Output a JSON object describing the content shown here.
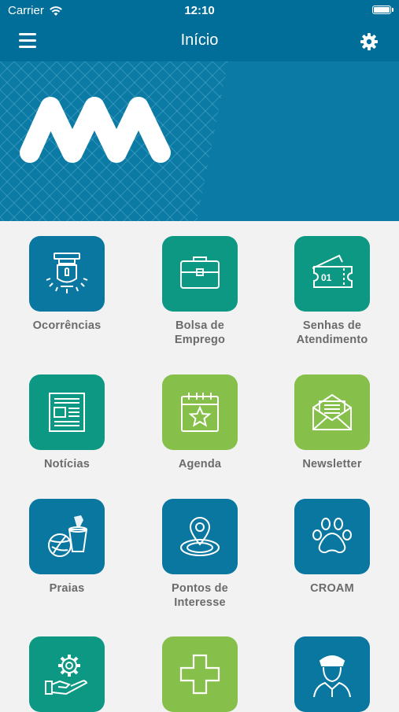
{
  "status": {
    "carrier": "Carrier",
    "time": "12:10"
  },
  "nav": {
    "title": "Início",
    "menu_icon": "menu-icon",
    "settings_icon": "gear-icon"
  },
  "colors": {
    "header": "#006e99",
    "blue_tile": "#0a77a1",
    "teal_tile": "#0c9882",
    "green_tile": "#86c04a",
    "label": "#6b6b6b",
    "background": "#f2f2f2"
  },
  "tiles": [
    {
      "label": "Ocorrências",
      "icon": "siren-icon",
      "color": "blue"
    },
    {
      "label": "Bolsa de\nEmprego",
      "icon": "briefcase-icon",
      "color": "teal"
    },
    {
      "label": "Senhas de\nAtendimento",
      "icon": "ticket-icon",
      "color": "teal",
      "icon_text": "01"
    },
    {
      "label": "Notícias",
      "icon": "newspaper-icon",
      "color": "teal"
    },
    {
      "label": "Agenda",
      "icon": "calendar-star-icon",
      "color": "green"
    },
    {
      "label": "Newsletter",
      "icon": "envelope-letter-icon",
      "color": "green"
    },
    {
      "label": "Praias",
      "icon": "beach-bucket-icon",
      "color": "blue"
    },
    {
      "label": "Pontos de\nInteresse",
      "icon": "map-pin-icon",
      "color": "blue"
    },
    {
      "label": "CROAM",
      "icon": "paw-icon",
      "color": "blue"
    },
    {
      "label": "",
      "icon": "hand-gear-icon",
      "color": "teal"
    },
    {
      "label": "",
      "icon": "medical-cross-icon",
      "color": "green"
    },
    {
      "label": "",
      "icon": "police-officer-icon",
      "color": "blue"
    }
  ]
}
